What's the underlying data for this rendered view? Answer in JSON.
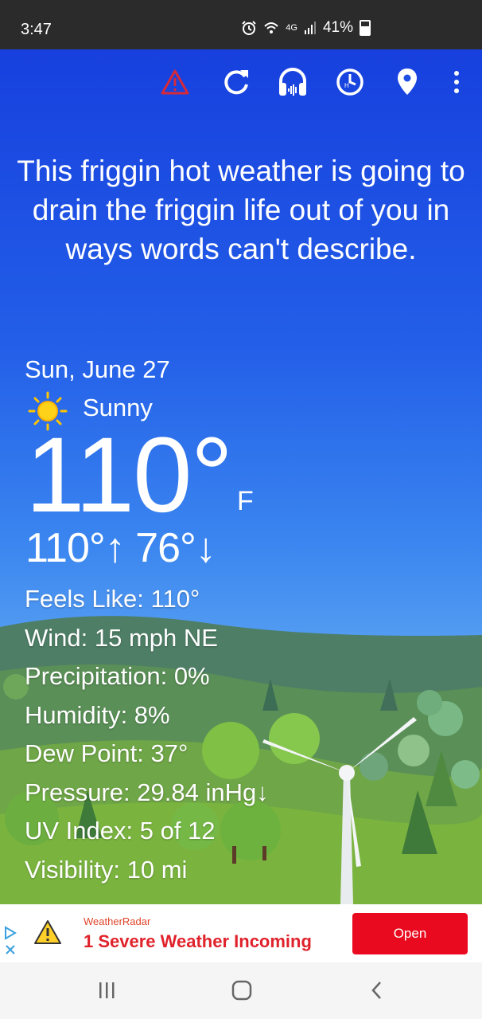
{
  "status_bar": {
    "time": "3:47",
    "network": "4G",
    "battery": "41%",
    "icons": [
      "alarm-icon",
      "wifi-icon",
      "signal-icon",
      "battery-icon"
    ]
  },
  "toolbar": {
    "icons": [
      "alert-triangle-icon",
      "refresh-icon",
      "headphones-icon",
      "history-clock-icon",
      "location-pin-icon",
      "more-vert-icon"
    ],
    "alert_color": "#d62a3a"
  },
  "headline": "This friggin hot weather is going to drain the friggin life out of you in ways words can't describe.",
  "current": {
    "date": "Sun, June 27",
    "condition_icon": "sun-icon",
    "condition": "Sunny",
    "temperature": "110°",
    "unit": "F",
    "high_low": "110°↑ 76°↓"
  },
  "details": [
    "Feels Like: 110°",
    "Wind: 15 mph NE",
    "Precipitation: 0%",
    "Humidity: 8%",
    "Dew Point: 37°",
    "Pressure: 29.84 inHg↓",
    "UV Index: 5 of 12",
    "Visibility: 10 mi"
  ],
  "ad": {
    "brand": "WeatherRadar",
    "title": "1 Severe Weather Incoming",
    "button": "Open",
    "button_color": "#ea0a1f"
  },
  "nav_bar": {
    "icons": [
      "recents-icon",
      "home-icon",
      "back-icon"
    ]
  }
}
